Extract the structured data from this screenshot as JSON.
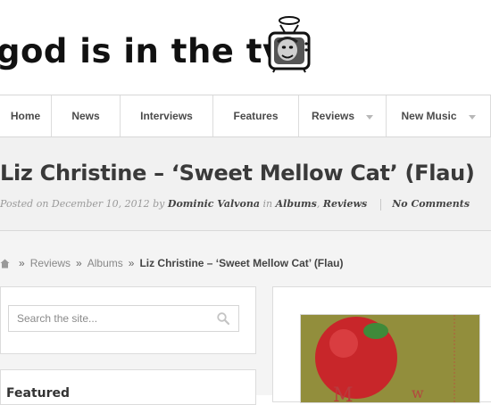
{
  "site": {
    "name": "god is in the tv",
    "logo_icon": "tv-head-halo-icon"
  },
  "nav": {
    "items": [
      {
        "label": "Home",
        "dropdown": false
      },
      {
        "label": "News",
        "dropdown": false
      },
      {
        "label": "Interviews",
        "dropdown": false
      },
      {
        "label": "Features",
        "dropdown": false
      },
      {
        "label": "Reviews",
        "dropdown": true
      },
      {
        "label": "New Music",
        "dropdown": true
      }
    ]
  },
  "post": {
    "title": "Liz Christine – ‘Sweet Mellow Cat’ (Flau)",
    "posted_on_prefix": "Posted on",
    "date": "December 10, 2012",
    "by": "by",
    "author": "Dominic Valvona",
    "in": "in",
    "category_1": "Albums",
    "comma": ",",
    "category_2": "Reviews",
    "comments": "No Comments"
  },
  "breadcrumb": {
    "separator": "»",
    "items": [
      "Reviews",
      "Albums"
    ],
    "current": "Liz Christine – ‘Sweet Mellow Cat’ (Flau)"
  },
  "sidebar": {
    "search_placeholder": "Search the site...",
    "widget2_title": "Featured"
  },
  "colors": {
    "title_band_bg": "#f1f1f1",
    "content_bg": "#f4f4f4",
    "album_art_bg": "#8b8a3b",
    "apple_red": "#c8262a"
  }
}
